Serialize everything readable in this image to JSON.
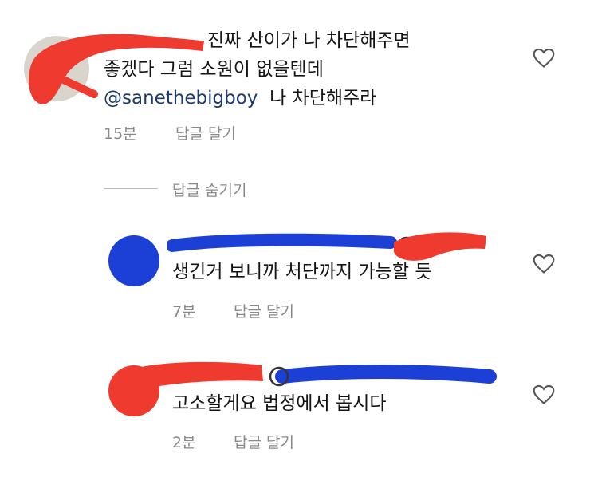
{
  "comments": [
    {
      "text_lines": [
        "진짜 산이가 나 차단해주면",
        "좋겠다 그럼 소원이 없을텐데"
      ],
      "mention": "@sanethebigboy",
      "tail": "나 차단해주라",
      "time": "15분",
      "reply_label": "답글 달기"
    },
    {
      "text_lines": [
        "생긴거 보니까 처단까지 가능할 듯"
      ],
      "time": "7분",
      "reply_label": "답글 달기"
    },
    {
      "text_lines": [
        "고소할게요 법정에서 봅시다"
      ],
      "time": "2분",
      "reply_label": "답글 달기"
    }
  ],
  "hide_replies_label": "답글 숨기기",
  "icons": {
    "like": "heart-outline-icon"
  },
  "colors": {
    "redaction_red": "#ee3a2f",
    "redaction_blue": "#1c3fd6",
    "meta_gray": "#8a8a8a",
    "mention": "#1d3a6b"
  }
}
